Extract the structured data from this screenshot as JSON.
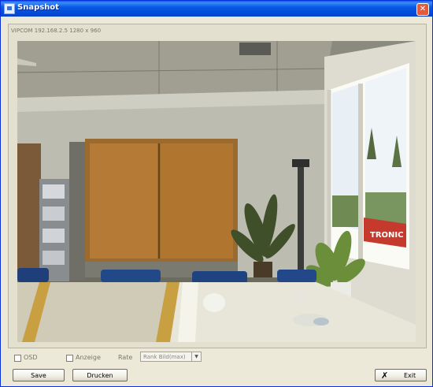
{
  "window": {
    "title": "Snapshot",
    "close_symbol": "✕"
  },
  "video": {
    "caption": "VIPCOM 192.168.2.5  1280 x 960",
    "logo_text": "TRONIC"
  },
  "controls": {
    "checkbox1_label": "OSD",
    "checkbox2_label": "Anzeige",
    "select_label": "Rate",
    "select_value": "Rank Bild(max)"
  },
  "buttons": {
    "save": "Save",
    "print": "Drucken",
    "close": "Exit",
    "close_icon_symbol": "✗"
  }
}
